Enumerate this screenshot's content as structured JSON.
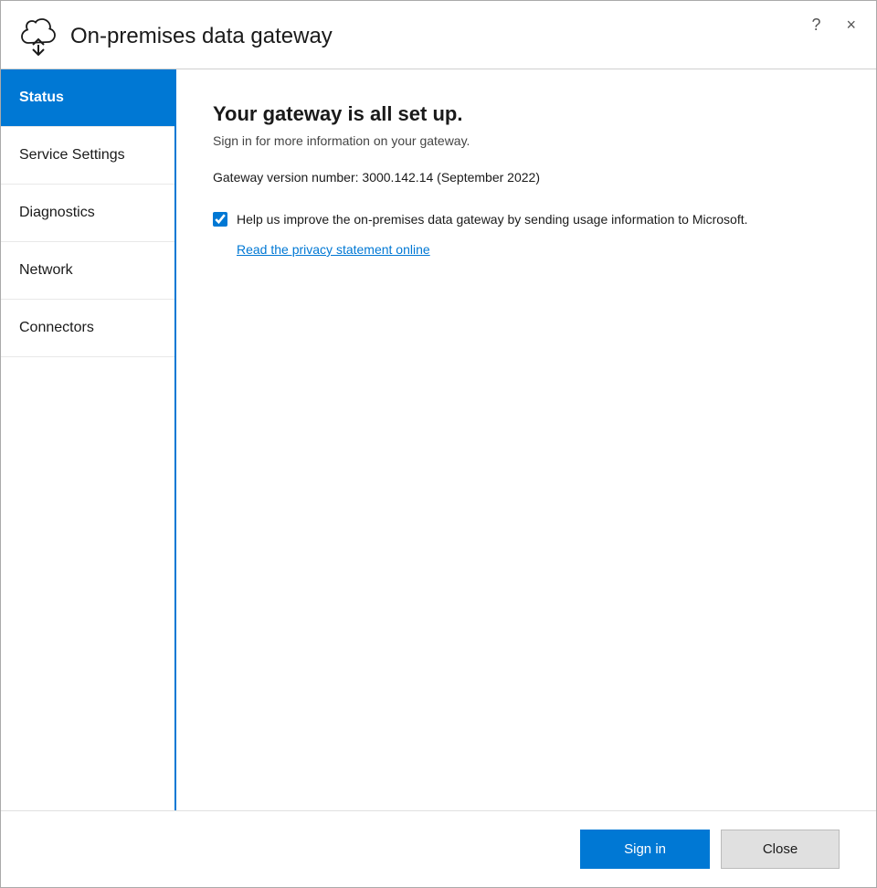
{
  "titleBar": {
    "title": "On-premises data gateway",
    "helpBtn": "?",
    "closeBtn": "×"
  },
  "sidebar": {
    "items": [
      {
        "id": "status",
        "label": "Status",
        "active": true
      },
      {
        "id": "service-settings",
        "label": "Service Settings",
        "active": false
      },
      {
        "id": "diagnostics",
        "label": "Diagnostics",
        "active": false
      },
      {
        "id": "network",
        "label": "Network",
        "active": false
      },
      {
        "id": "connectors",
        "label": "Connectors",
        "active": false
      }
    ]
  },
  "content": {
    "title": "Your gateway is all set up.",
    "subtitle": "Sign in for more information on your gateway.",
    "versionText": "Gateway version number: 3000.142.14 (September 2022)",
    "checkboxLabel": "Help us improve the on-premises data gateway by sending usage information to Microsoft.",
    "checkboxChecked": true,
    "privacyLinkText": "Read the privacy statement online"
  },
  "footer": {
    "signinLabel": "Sign in",
    "closeLabel": "Close"
  }
}
